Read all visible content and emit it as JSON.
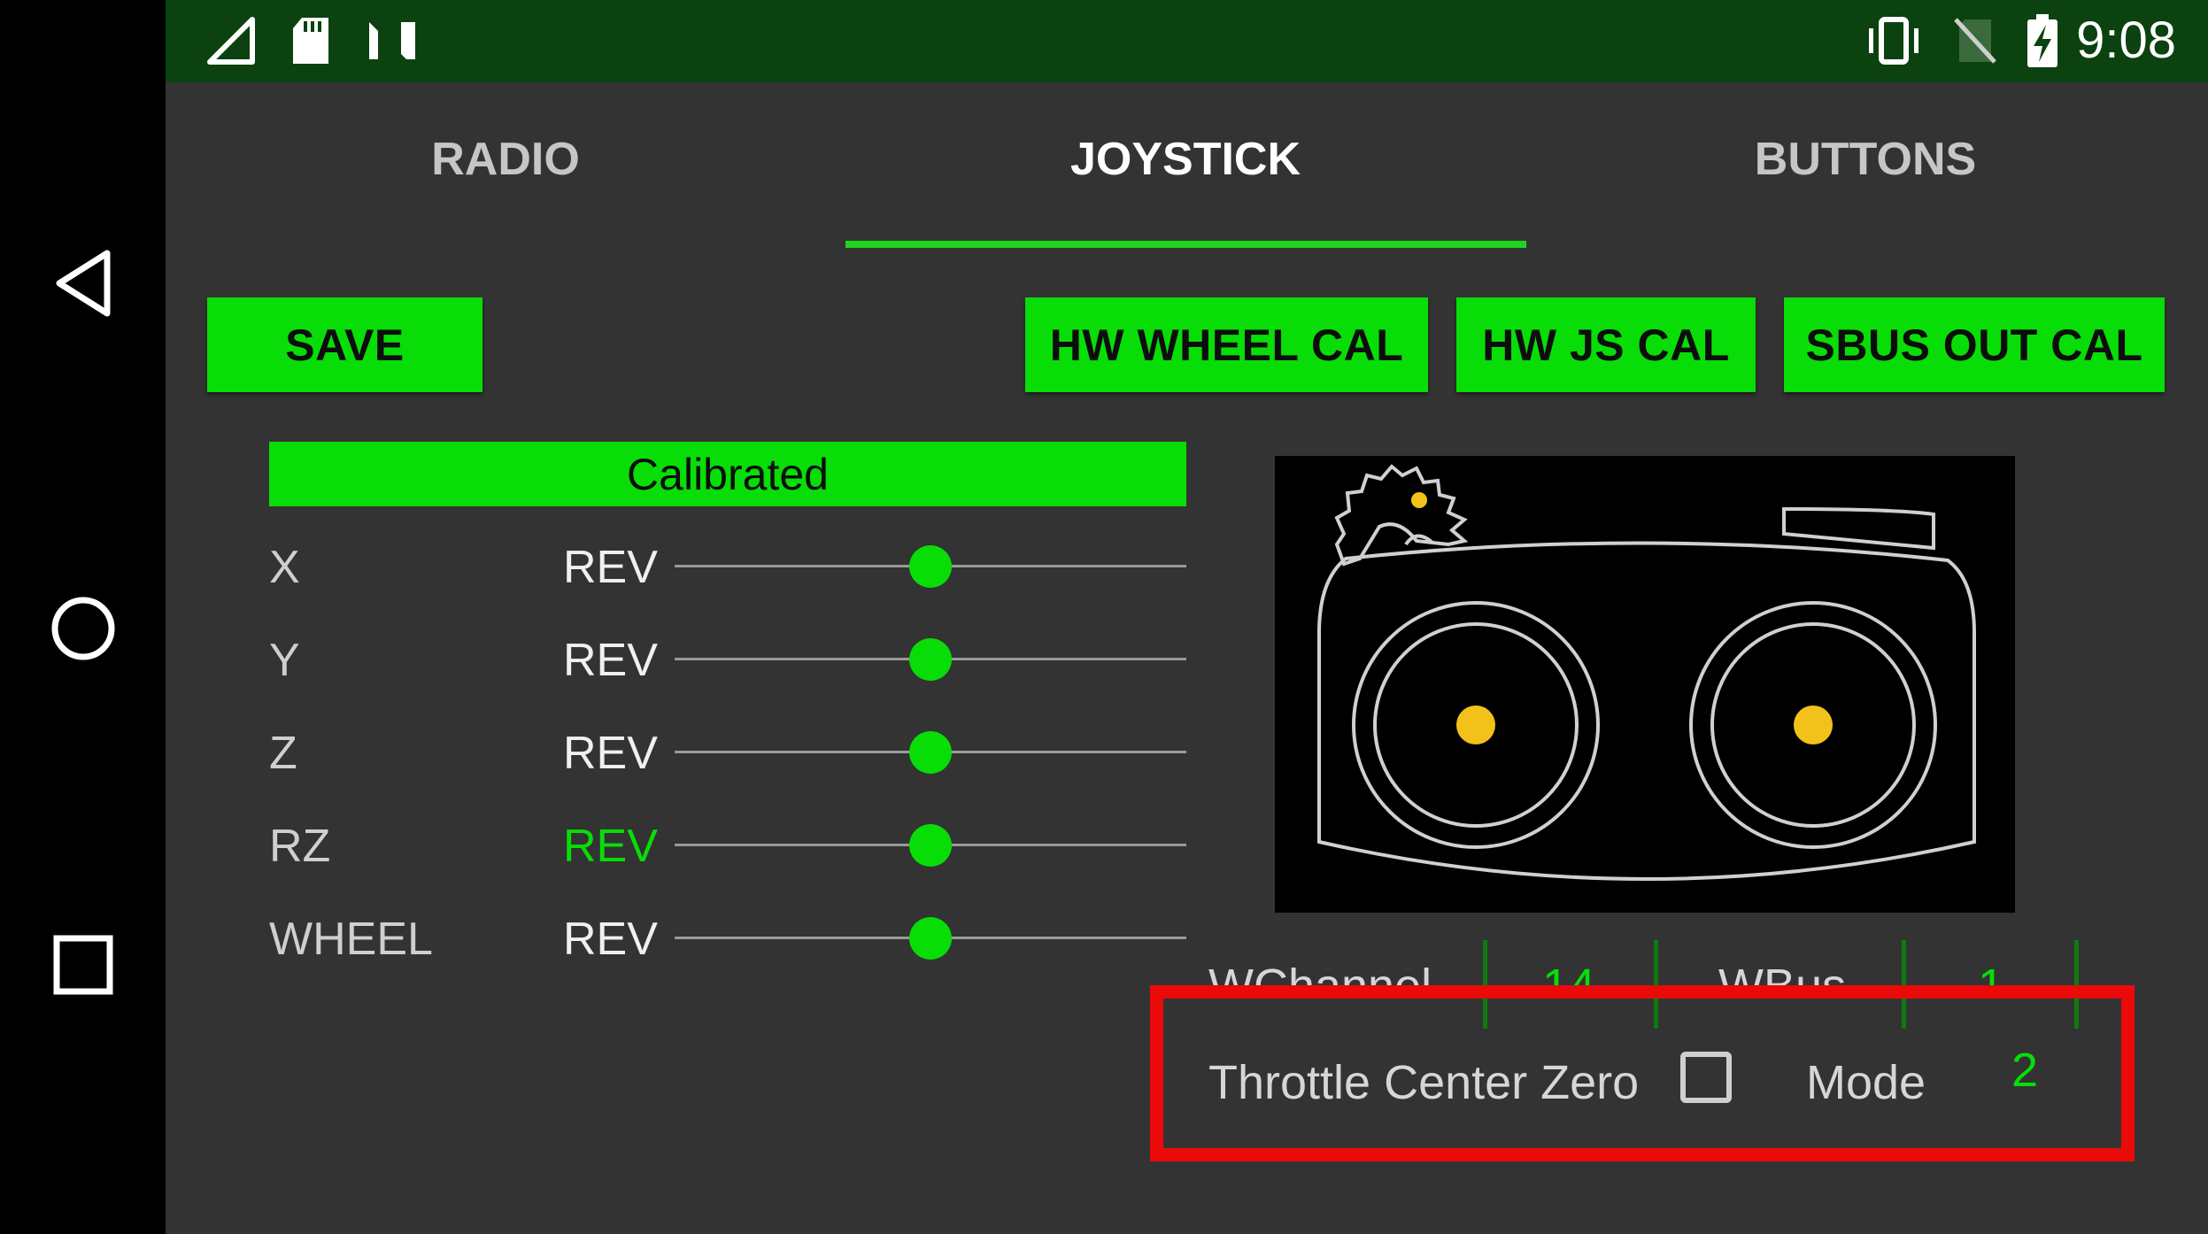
{
  "status_bar": {
    "time": "9:08",
    "icons_left": [
      "signal-icon",
      "sd-card-icon",
      "n-logo-icon"
    ],
    "icons_right": [
      "vibrate-icon",
      "no-sim-icon",
      "battery-charging-icon"
    ]
  },
  "nav": {
    "buttons": [
      "back-icon",
      "home-icon",
      "recents-icon"
    ]
  },
  "tabs": [
    {
      "label": "RADIO",
      "active": false
    },
    {
      "label": "JOYSTICK",
      "active": true
    },
    {
      "label": "BUTTONS",
      "active": false
    }
  ],
  "toolbar": {
    "save": "SAVE",
    "hw_wheel_cal": "HW WHEEL CAL",
    "hw_js_cal": "HW JS CAL",
    "sbus_out_cal": "SBUS OUT CAL"
  },
  "status": "Calibrated",
  "axes": [
    {
      "name": "X",
      "rev": "REV",
      "rev_active": false,
      "value": 0.5
    },
    {
      "name": "Y",
      "rev": "REV",
      "rev_active": false,
      "value": 0.5
    },
    {
      "name": "Z",
      "rev": "REV",
      "rev_active": false,
      "value": 0.5
    },
    {
      "name": "RZ",
      "rev": "REV",
      "rev_active": true,
      "value": 0.5
    },
    {
      "name": "WHEEL",
      "rev": "REV",
      "rev_active": false,
      "value": 0.5
    }
  ],
  "settings": {
    "wchannel_label": "WChannel",
    "wchannel_value": "14",
    "wbus_label": "WBus",
    "wbus_value": "1",
    "throttle_center_zero_label": "Throttle Center Zero",
    "throttle_center_zero_checked": false,
    "mode_label": "Mode",
    "mode_value": "2"
  },
  "colors": {
    "accent": "#08dd08",
    "background": "#333333",
    "status_bar": "#0b4210",
    "highlight": "#ea0a0a"
  }
}
